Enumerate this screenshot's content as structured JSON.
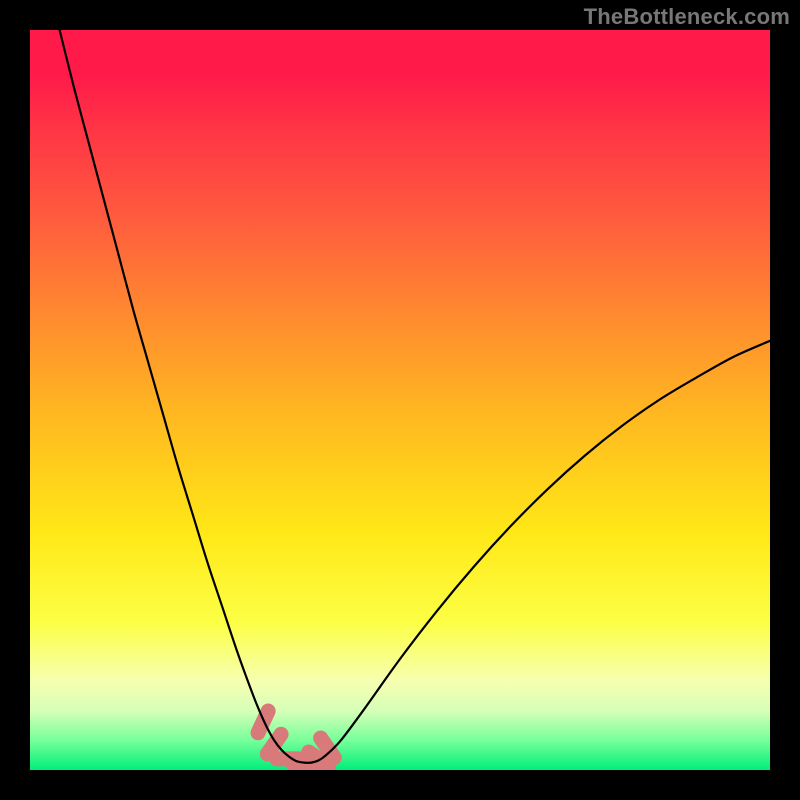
{
  "watermark": "TheBottleneck.com",
  "colors": {
    "frame": "#000000",
    "gradient_top": "#ff1a4a",
    "gradient_bottom": "#00ef7a",
    "curve": "#000000",
    "marker": "#d87a7a"
  },
  "chart_data": {
    "type": "line",
    "title": "",
    "xlabel": "",
    "ylabel": "",
    "xlim": [
      0,
      100
    ],
    "ylim": [
      0,
      100
    ],
    "x": [
      4.0,
      6.0,
      8.0,
      10.0,
      12.0,
      14.0,
      16.0,
      18.0,
      20.0,
      22.0,
      24.0,
      26.0,
      28.0,
      30.0,
      31.0,
      32.0,
      33.0,
      34.0,
      35.0,
      36.0,
      37.0,
      38.0,
      39.0,
      40.0,
      42.0,
      45.0,
      50.0,
      55.0,
      60.0,
      65.0,
      70.0,
      75.0,
      80.0,
      85.0,
      90.0,
      95.0,
      100.0
    ],
    "values": [
      100.0,
      92.0,
      84.5,
      77.0,
      69.5,
      62.0,
      55.0,
      48.0,
      41.0,
      34.5,
      28.0,
      22.0,
      16.0,
      10.5,
      8.0,
      5.8,
      4.0,
      2.7,
      1.8,
      1.2,
      1.0,
      1.0,
      1.3,
      2.0,
      4.0,
      8.0,
      15.0,
      21.5,
      27.5,
      33.0,
      38.0,
      42.5,
      46.5,
      50.0,
      53.0,
      55.8,
      58.0
    ],
    "markers": {
      "x": [
        31.5,
        33.0,
        35.0,
        37.0,
        39.0,
        40.2
      ],
      "y": [
        6.5,
        3.5,
        1.5,
        1.0,
        1.5,
        3.0
      ]
    }
  }
}
